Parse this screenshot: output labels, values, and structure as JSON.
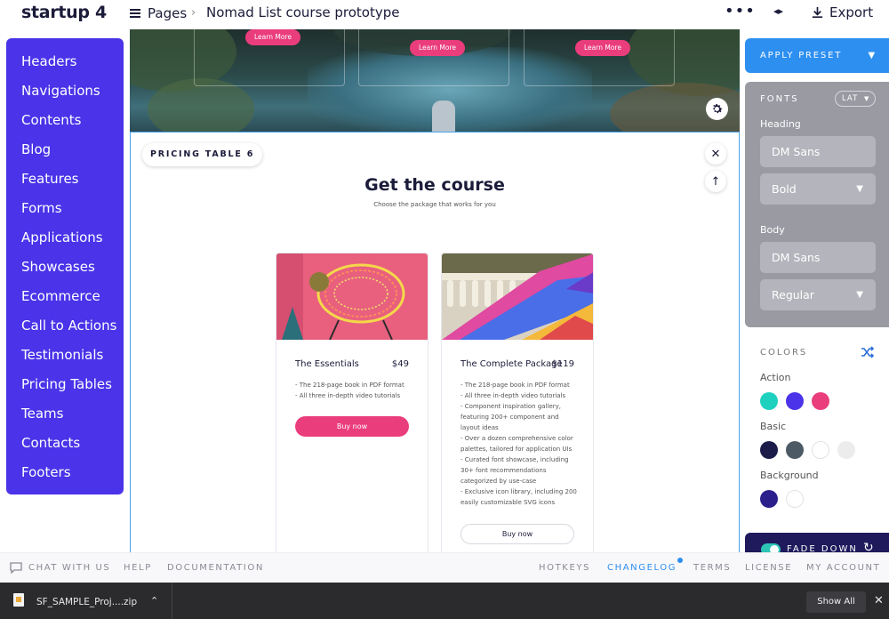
{
  "app": {
    "logo": "startup 4",
    "pages_label": "Pages",
    "breadcrumb_sep": "›",
    "project_title": "Nomad List course prototype",
    "more": "•••",
    "collapse": "◂▸",
    "export_label": "Export"
  },
  "sidebar": {
    "items": [
      "Headers",
      "Navigations",
      "Contents",
      "Blog",
      "Features",
      "Forms",
      "Applications",
      "Showcases",
      "Ecommerce",
      "Call to Actions",
      "Testimonials",
      "Pricing Tables",
      "Teams",
      "Contacts",
      "Footers"
    ]
  },
  "hero": {
    "learn_more": "Learn More"
  },
  "block": {
    "label": "PRICING TABLE 6",
    "close": "✕",
    "up": "↑",
    "title": "Get the course",
    "subtitle": "Choose the package that works for you"
  },
  "cards": [
    {
      "name": "The Essentials",
      "price": "$49",
      "features": [
        "- The 218-page book in PDF format",
        "- All three in-depth video tutorials"
      ],
      "button": "Buy now"
    },
    {
      "name": "The Complete Package",
      "price": "$119",
      "features": [
        "- The 218-page book in PDF format",
        "- All three in-depth video tutorials",
        "- Component inspiration gallery,",
        "featuring 200+ component and",
        "layout ideas",
        "- Over a dozen comprehensive color",
        "palettes, tailored for application UIs",
        "- Curated font showcase, including",
        "30+ font recommendations",
        "categorized by use-case",
        "- Exclusive icon library, including 200",
        "easily customizable SVG icons"
      ],
      "button": "Buy now"
    }
  ],
  "right_panel": {
    "apply_preset": "APPLY PRESET",
    "fonts_label": "FONTS",
    "lang": "LAT",
    "heading_label": "Heading",
    "heading_font": "DM Sans",
    "heading_weight": "Bold",
    "body_label": "Body",
    "body_font": "DM Sans",
    "body_weight": "Regular",
    "colors_label": "COLORS",
    "action_label": "Action",
    "action_colors": [
      "#1ed1be",
      "#4a33e8",
      "#ea3d7c"
    ],
    "basic_label": "Basic",
    "basic_colors": [
      "#1b1b4a",
      "#4c5a66",
      "#ffffff",
      "#ececec"
    ],
    "background_label": "Background",
    "background_colors": [
      "#2b1f8c",
      "#ffffff"
    ],
    "animation_label": "FADE DOWN"
  },
  "footer": {
    "chat": "CHAT WITH US",
    "help": "HELP",
    "documentation": "DOCUMENTATION",
    "hotkeys": "HOTKEYS",
    "changelog": "CHANGELOG",
    "terms": "TERMS",
    "license": "LICENSE",
    "account": "MY ACCOUNT",
    "changelog_color": "#2d8ff0"
  },
  "downloads": {
    "file_name": "SF_SAMPLE_Proj....zip",
    "show_all": "Show All",
    "close": "✕"
  }
}
